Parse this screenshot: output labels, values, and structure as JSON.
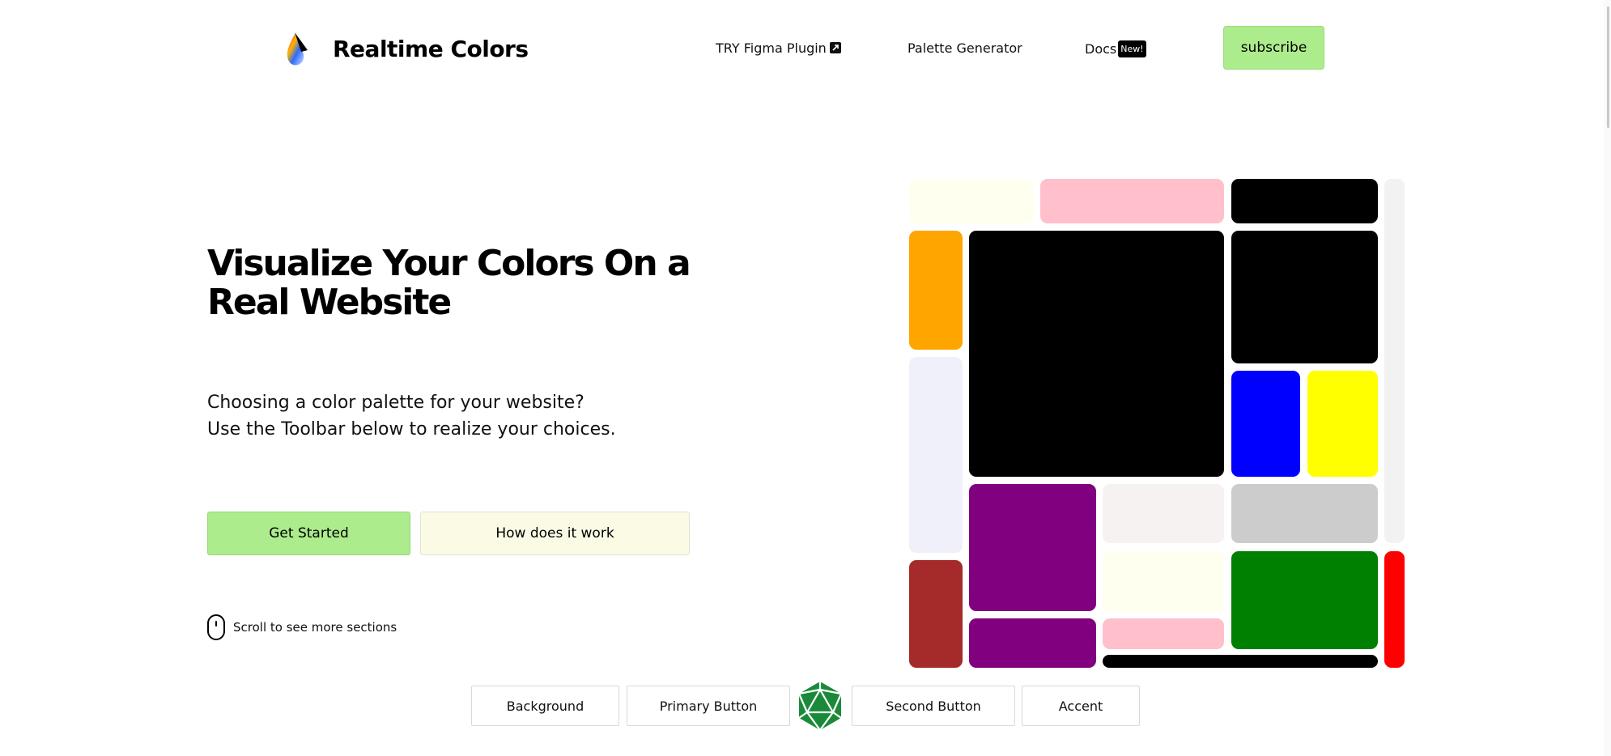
{
  "header": {
    "logo_text": "Realtime Colors",
    "nav": {
      "figma": "TRY Figma Plugin",
      "palette": "Palette Generator",
      "docs": "Docs",
      "docs_badge": "New!"
    },
    "subscribe_label": "subscribe"
  },
  "hero": {
    "title": "Visualize Your Colors On a Real Website",
    "subtitle_line1": "Choosing a color palette for your website?",
    "subtitle_line2": "Use the Toolbar below to realize your choices.",
    "cta_primary": "Get Started",
    "cta_secondary": "How does it work",
    "scroll_hint": "Scroll to see more sections"
  },
  "mosaic": {
    "colors": {
      "ivory": "#fffff0",
      "pink": "#ffc0cb",
      "black": "#000000",
      "orange": "#ffa500",
      "lavender": "#f0f0fb",
      "blue": "#0000ff",
      "yellow": "#ffff00",
      "purple": "#800080",
      "snow": "#f7f2f2",
      "silver": "#cccccc",
      "brown": "#a52a2a",
      "green": "#008000",
      "red": "#ff0000",
      "whitesmoke": "#f2f2f2"
    }
  },
  "toolbar": {
    "background": "Background",
    "primary_button": "Primary Button",
    "randomize_icon": "dice-icon",
    "second_button": "Second Button",
    "accent": "Accent"
  },
  "theme": {
    "primary": "#acec8c",
    "secondary": "#fbfbe5",
    "dice": "#1a8a3a"
  }
}
